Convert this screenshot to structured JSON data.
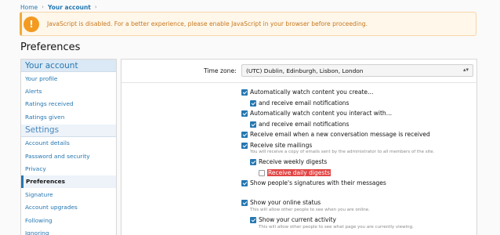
{
  "breadcrumb": {
    "home": "Home",
    "sep": "›",
    "current": "Your account"
  },
  "notice": {
    "icon": "!",
    "text": "JavaScript is disabled. For a better experience, please enable JavaScript in your browser before proceeding."
  },
  "page_title": "Preferences",
  "sidebar": {
    "account_header": "Your account",
    "account_items": [
      "Your profile",
      "Alerts",
      "Ratings received",
      "Ratings given"
    ],
    "settings_header": "Settings",
    "settings_items": [
      "Account details",
      "Password and security",
      "Privacy",
      "Preferences",
      "Signature",
      "Account upgrades",
      "Following",
      "Ignoring"
    ],
    "active_item": "Preferences"
  },
  "main": {
    "timezone_label": "Time zone:",
    "timezone_value": "(UTC) Dublin, Edinburgh, Lisbon, London",
    "options": [
      {
        "label": "Automatically watch content you create…",
        "checked": true
      },
      {
        "label": "and receive email notifications",
        "checked": true
      },
      {
        "label": "Automatically watch content you interact with…",
        "checked": true
      },
      {
        "label": "and receive email notifications",
        "checked": true
      },
      {
        "label": "Receive email when a new conversation message is received",
        "checked": true
      },
      {
        "label": "Receive site mailings",
        "checked": true
      },
      {
        "label": "Receive weekly digests",
        "checked": true
      },
      {
        "label": "Receive daily digests",
        "checked": false
      },
      {
        "label": "Show people's signatures with their messages",
        "checked": true
      },
      {
        "label": "Show your online status",
        "checked": true
      },
      {
        "label": "Show your current activity",
        "checked": true
      }
    ],
    "hints": {
      "site_mailings": "You will receive a copy of emails sent by the administrator to all members of the site.",
      "online_status": "This will allow other people to see when you are online.",
      "current_activity": "This will allow other people to see what page you are currently viewing."
    }
  },
  "colors": {
    "accent": "#2577b1",
    "notice_bg": "#fef7ea",
    "notice_icon": "#f39a20",
    "highlight": "#e24545"
  }
}
